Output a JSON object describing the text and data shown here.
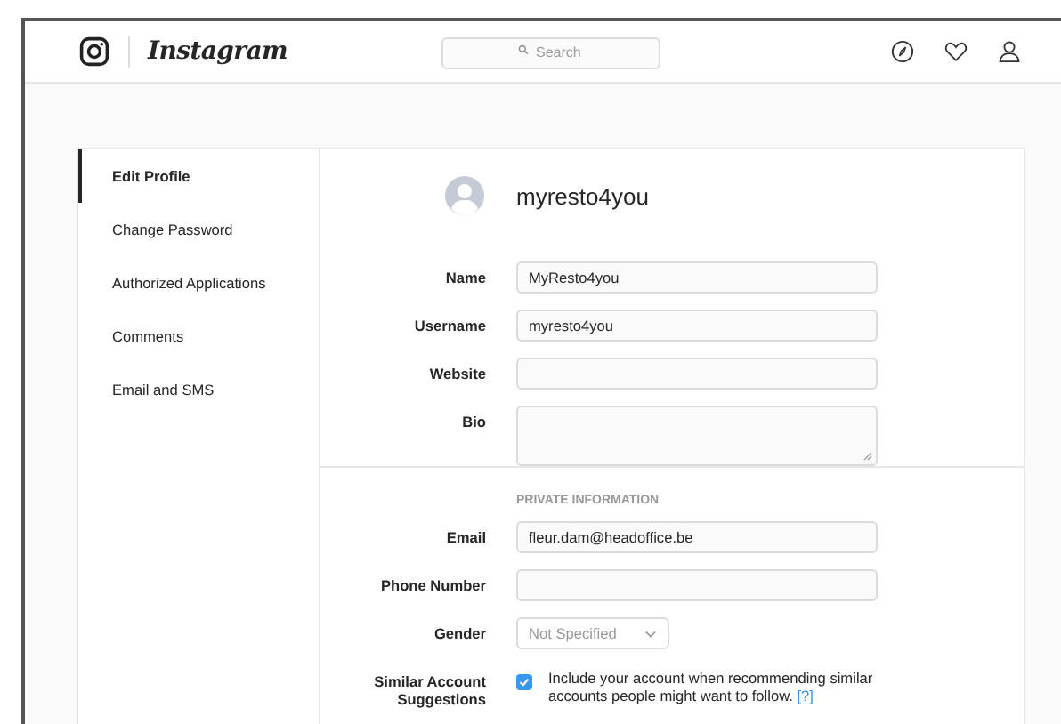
{
  "header": {
    "logo_text": "Instagram",
    "search": {
      "placeholder": "Search"
    }
  },
  "sidebar": {
    "items": [
      {
        "label": "Edit Profile",
        "selected": true
      },
      {
        "label": "Change Password",
        "selected": false
      },
      {
        "label": "Authorized Applications",
        "selected": false
      },
      {
        "label": "Comments",
        "selected": false
      },
      {
        "label": "Email and SMS",
        "selected": false
      }
    ]
  },
  "profile": {
    "username": "myresto4you"
  },
  "fields": [
    {
      "kind": "text",
      "label": "Name",
      "value": "MyResto4you"
    },
    {
      "kind": "text",
      "label": "Username",
      "value": "myresto4you"
    },
    {
      "kind": "text",
      "label": "Website"
    },
    {
      "kind": "textarea",
      "label": "Bio"
    },
    {
      "kind": "section",
      "label": "PRIVATE INFORMATION"
    },
    {
      "kind": "text",
      "label": "Email",
      "value": "fleur.dam@headoffice.be"
    },
    {
      "kind": "text",
      "label": "Phone Number"
    },
    {
      "kind": "select",
      "label": "Gender",
      "value": "Not Specified"
    },
    {
      "kind": "checkbox",
      "label": "Similar Account Suggestions",
      "checked": true,
      "text": "Include your account when recommending similar accounts people might want to follow.",
      "link": "[?]"
    }
  ]
}
